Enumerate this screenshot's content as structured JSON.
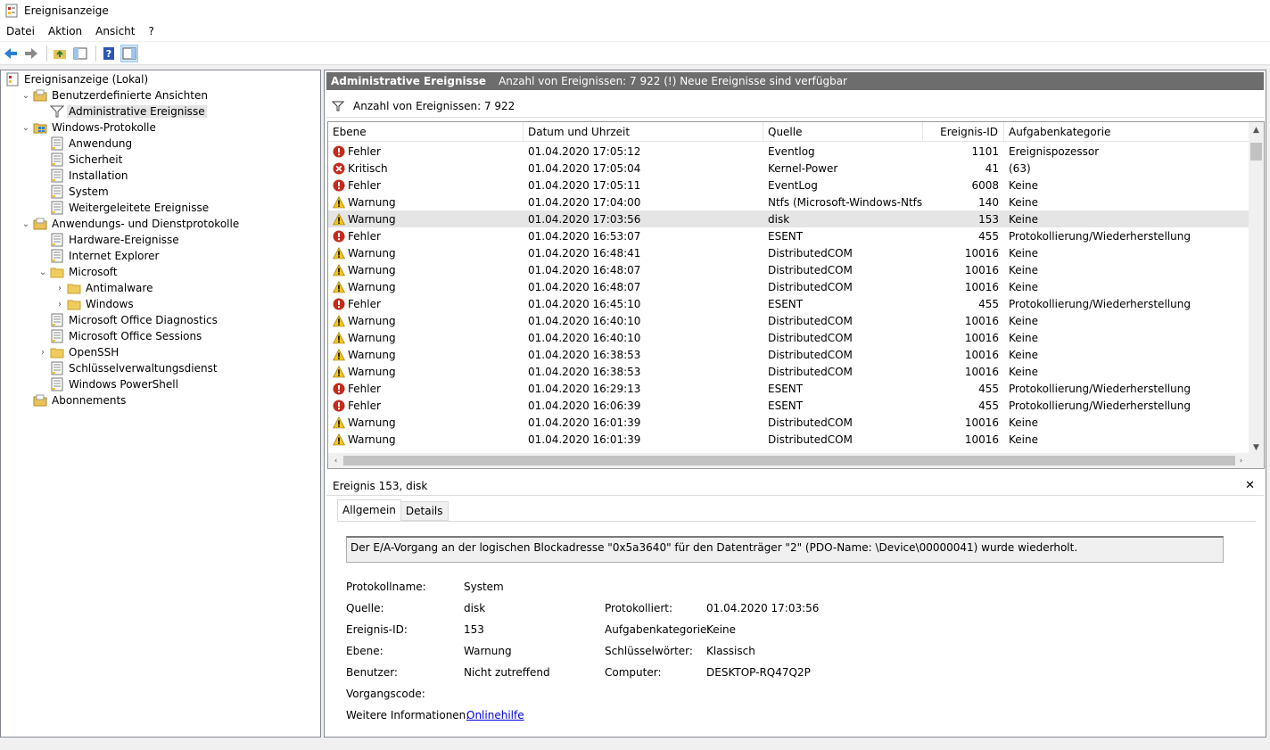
{
  "window": {
    "title": "Ereignisanzeige"
  },
  "menu": [
    "Datei",
    "Aktion",
    "Ansicht",
    "?"
  ],
  "tree": [
    {
      "label": "Ereignisanzeige (Lokal)",
      "indent": 0,
      "exp": "",
      "icon": "event-viewer"
    },
    {
      "label": "Benutzerdefinierte Ansichten",
      "indent": 1,
      "exp": "open",
      "icon": "folder-special"
    },
    {
      "label": "Administrative Ereignisse",
      "indent": 2,
      "exp": "",
      "icon": "filter",
      "selected": true
    },
    {
      "label": "Windows-Protokolle",
      "indent": 1,
      "exp": "open",
      "icon": "folder-windows"
    },
    {
      "label": "Anwendung",
      "indent": 2,
      "exp": "",
      "icon": "log"
    },
    {
      "label": "Sicherheit",
      "indent": 2,
      "exp": "",
      "icon": "log"
    },
    {
      "label": "Installation",
      "indent": 2,
      "exp": "",
      "icon": "log"
    },
    {
      "label": "System",
      "indent": 2,
      "exp": "",
      "icon": "log"
    },
    {
      "label": "Weitergeleitete Ereignisse",
      "indent": 2,
      "exp": "",
      "icon": "log"
    },
    {
      "label": "Anwendungs- und Dienstprotokolle",
      "indent": 1,
      "exp": "open",
      "icon": "folder-special"
    },
    {
      "label": "Hardware-Ereignisse",
      "indent": 2,
      "exp": "",
      "icon": "log"
    },
    {
      "label": "Internet Explorer",
      "indent": 2,
      "exp": "",
      "icon": "log"
    },
    {
      "label": "Microsoft",
      "indent": 2,
      "exp": "open",
      "icon": "folder"
    },
    {
      "label": "Antimalware",
      "indent": 3,
      "exp": "closed",
      "icon": "folder"
    },
    {
      "label": "Windows",
      "indent": 3,
      "exp": "closed",
      "icon": "folder"
    },
    {
      "label": "Microsoft Office Diagnostics",
      "indent": 2,
      "exp": "",
      "icon": "log"
    },
    {
      "label": "Microsoft Office Sessions",
      "indent": 2,
      "exp": "",
      "icon": "log"
    },
    {
      "label": "OpenSSH",
      "indent": 2,
      "exp": "closed",
      "icon": "folder"
    },
    {
      "label": "Schlüsselverwaltungsdienst",
      "indent": 2,
      "exp": "",
      "icon": "log"
    },
    {
      "label": "Windows PowerShell",
      "indent": 2,
      "exp": "",
      "icon": "log"
    },
    {
      "label": "Abonnements",
      "indent": 1,
      "exp": "",
      "icon": "folder-special"
    }
  ],
  "header": {
    "title": "Administrative Ereignisse",
    "info": "Anzahl von Ereignissen: 7 922 (!) Neue Ereignisse sind verfügbar"
  },
  "filter": {
    "text": "Anzahl von Ereignissen: 7 922"
  },
  "columns": [
    "Ebene",
    "Datum und Uhrzeit",
    "Quelle",
    "Ereignis-ID",
    "Aufgabenkategorie"
  ],
  "events": [
    {
      "level": "Fehler",
      "type": "error",
      "date": "01.04.2020 17:05:12",
      "source": "Eventlog",
      "id": "1101",
      "category": "Ereignispozessor"
    },
    {
      "level": "Kritisch",
      "type": "critical",
      "date": "01.04.2020 17:05:04",
      "source": "Kernel-Power",
      "id": "41",
      "category": "(63)"
    },
    {
      "level": "Fehler",
      "type": "error",
      "date": "01.04.2020 17:05:11",
      "source": "EventLog",
      "id": "6008",
      "category": "Keine"
    },
    {
      "level": "Warnung",
      "type": "warning",
      "date": "01.04.2020 17:04:00",
      "source": "Ntfs (Microsoft-Windows-Ntfs)",
      "id": "140",
      "category": "Keine"
    },
    {
      "level": "Warnung",
      "type": "warning",
      "date": "01.04.2020 17:03:56",
      "source": "disk",
      "id": "153",
      "category": "Keine",
      "selected": true
    },
    {
      "level": "Fehler",
      "type": "error",
      "date": "01.04.2020 16:53:07",
      "source": "ESENT",
      "id": "455",
      "category": "Protokollierung/Wiederherstellung"
    },
    {
      "level": "Warnung",
      "type": "warning",
      "date": "01.04.2020 16:48:41",
      "source": "DistributedCOM",
      "id": "10016",
      "category": "Keine"
    },
    {
      "level": "Warnung",
      "type": "warning",
      "date": "01.04.2020 16:48:07",
      "source": "DistributedCOM",
      "id": "10016",
      "category": "Keine"
    },
    {
      "level": "Warnung",
      "type": "warning",
      "date": "01.04.2020 16:48:07",
      "source": "DistributedCOM",
      "id": "10016",
      "category": "Keine"
    },
    {
      "level": "Fehler",
      "type": "error",
      "date": "01.04.2020 16:45:10",
      "source": "ESENT",
      "id": "455",
      "category": "Protokollierung/Wiederherstellung"
    },
    {
      "level": "Warnung",
      "type": "warning",
      "date": "01.04.2020 16:40:10",
      "source": "DistributedCOM",
      "id": "10016",
      "category": "Keine"
    },
    {
      "level": "Warnung",
      "type": "warning",
      "date": "01.04.2020 16:40:10",
      "source": "DistributedCOM",
      "id": "10016",
      "category": "Keine"
    },
    {
      "level": "Warnung",
      "type": "warning",
      "date": "01.04.2020 16:38:53",
      "source": "DistributedCOM",
      "id": "10016",
      "category": "Keine"
    },
    {
      "level": "Warnung",
      "type": "warning",
      "date": "01.04.2020 16:38:53",
      "source": "DistributedCOM",
      "id": "10016",
      "category": "Keine"
    },
    {
      "level": "Fehler",
      "type": "error",
      "date": "01.04.2020 16:29:13",
      "source": "ESENT",
      "id": "455",
      "category": "Protokollierung/Wiederherstellung"
    },
    {
      "level": "Fehler",
      "type": "error",
      "date": "01.04.2020 16:06:39",
      "source": "ESENT",
      "id": "455",
      "category": "Protokollierung/Wiederherstellung"
    },
    {
      "level": "Warnung",
      "type": "warning",
      "date": "01.04.2020 16:01:39",
      "source": "DistributedCOM",
      "id": "10016",
      "category": "Keine"
    },
    {
      "level": "Warnung",
      "type": "warning",
      "date": "01.04.2020 16:01:39",
      "source": "DistributedCOM",
      "id": "10016",
      "category": "Keine"
    }
  ],
  "detail": {
    "title": "Ereignis 153, disk",
    "tabs": [
      "Allgemein",
      "Details"
    ],
    "message": "Der E/A-Vorgang an der logischen Blockadresse \"0x5a3640\" für den Datenträger \"2\" (PDO-Name: \\Device\\00000041) wurde wiederholt.",
    "fields": {
      "protokollname_label": "Protokollname:",
      "protokollname": "System",
      "quelle_label": "Quelle:",
      "quelle": "disk",
      "protokolliert_label": "Protokolliert:",
      "protokolliert": "01.04.2020 17:03:56",
      "ereignis_id_label": "Ereignis-ID:",
      "ereignis_id": "153",
      "aufgabenkategorie_label": "Aufgabenkategorie:",
      "aufgabenkategorie": "Keine",
      "ebene_label": "Ebene:",
      "ebene": "Warnung",
      "schluesselwoerter_label": "Schlüsselwörter:",
      "schluesselwoerter": "Klassisch",
      "benutzer_label": "Benutzer:",
      "benutzer": "Nicht zutreffend",
      "computer_label": "Computer:",
      "computer": "DESKTOP-RQ47Q2P",
      "vorgangscode_label": "Vorgangscode:",
      "weitere_label": "Weitere Informationen:",
      "weitere_link": "Onlinehilfe"
    }
  },
  "colors": {
    "error": "#c42b1c",
    "warning": "#f5c518",
    "header_bg": "#6d6d6d",
    "selection": "#e5e5e5",
    "link": "#0000ee"
  }
}
